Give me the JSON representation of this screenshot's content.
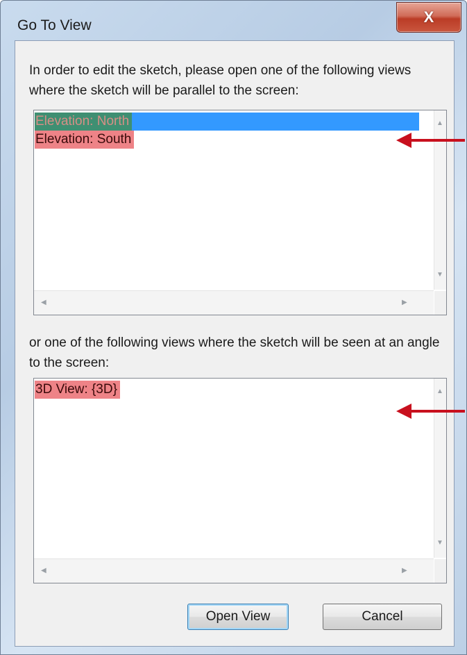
{
  "dialog": {
    "title": "Go To View",
    "close_glyph": "X"
  },
  "instructions": {
    "parallel": "In order to edit the sketch, please open one of the following views where the sketch will be parallel to the screen:",
    "angle": "or one of the following views where the sketch will be seen at an angle to the screen:"
  },
  "parallel_views": {
    "items": [
      {
        "label": "Elevation: North",
        "selected": true
      },
      {
        "label": "Elevation: South",
        "selected": false
      }
    ]
  },
  "angle_views": {
    "items": [
      {
        "label": "3D View: {3D}",
        "selected": false
      }
    ]
  },
  "buttons": {
    "open_view": "Open View",
    "cancel": "Cancel"
  },
  "annotations": {
    "highlight_color": "#ee8387",
    "arrow_color": "#c8101e"
  }
}
